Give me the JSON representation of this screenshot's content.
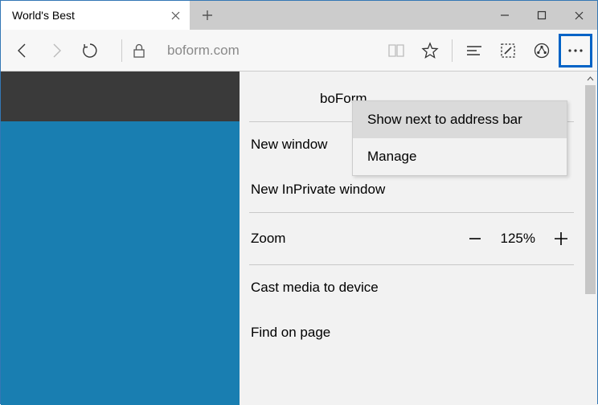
{
  "tab": {
    "title": "World's Best"
  },
  "address": "boform.com",
  "menu": {
    "extension_label": "boForm",
    "new_window": "New window",
    "new_inprivate": "New InPrivate window",
    "zoom_label": "Zoom",
    "zoom_value": "125%",
    "cast": "Cast media to device",
    "find": "Find on page"
  },
  "submenu": {
    "show_next": "Show next to address bar",
    "manage": "Manage"
  }
}
